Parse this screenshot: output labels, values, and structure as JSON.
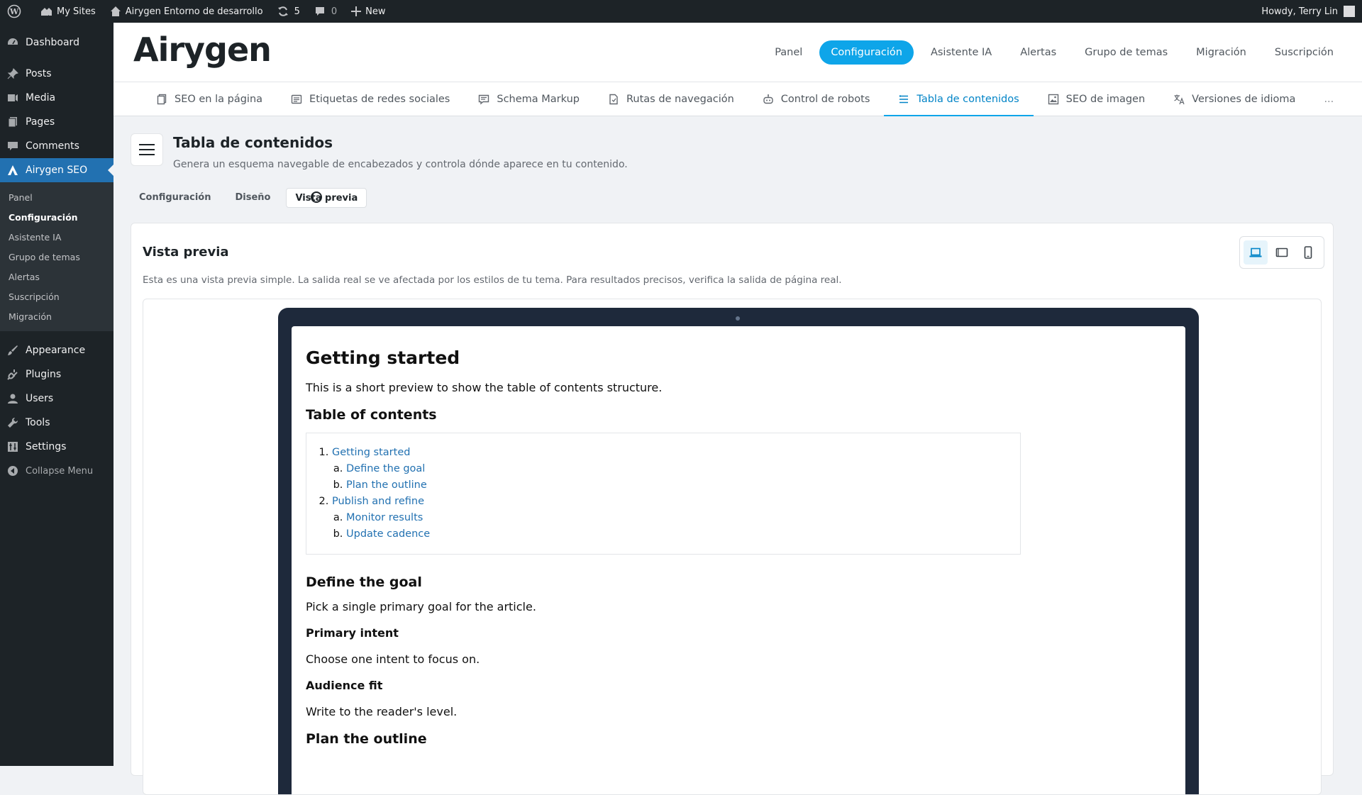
{
  "adminbar": {
    "my_sites": "My Sites",
    "site_name": "Airygen Entorno de desarrollo",
    "updates_count": "5",
    "comments_count": "0",
    "new_label": "New",
    "howdy": "Howdy, Terry Lin"
  },
  "sidebar": {
    "dashboard": "Dashboard",
    "posts": "Posts",
    "media": "Media",
    "pages": "Pages",
    "comments": "Comments",
    "airygen": "Airygen SEO",
    "submenu": [
      "Panel",
      "Configuración",
      "Asistente IA",
      "Grupo de temas",
      "Alertas",
      "Suscripción",
      "Migración"
    ],
    "appearance": "Appearance",
    "plugins": "Plugins",
    "users": "Users",
    "tools": "Tools",
    "settings": "Settings",
    "collapse": "Collapse Menu"
  },
  "logo_text": "Airygen",
  "topnav": [
    "Panel",
    "Configuración",
    "Asistente IA",
    "Alertas",
    "Grupo de temas",
    "Migración",
    "Suscripción"
  ],
  "subtabs": [
    {
      "label": "SEO en la página",
      "icon": "page-copy-icon"
    },
    {
      "label": "Etiquetas de redes sociales",
      "icon": "social-card-icon"
    },
    {
      "label": "Schema Markup",
      "icon": "schema-icon"
    },
    {
      "label": "Rutas de navegación",
      "icon": "breadcrumb-file-icon"
    },
    {
      "label": "Control de robots",
      "icon": "robot-icon"
    },
    {
      "label": "Tabla de contenidos",
      "icon": "list-icon"
    },
    {
      "label": "SEO de imagen",
      "icon": "image-icon"
    },
    {
      "label": "Versiones de idioma",
      "icon": "translate-icon"
    }
  ],
  "subtabs_more": "...",
  "page": {
    "title": "Tabla de contenidos",
    "description": "Genera un esquema navegable de encabezados y controla dónde aparece en tu contenido."
  },
  "section_tabs": [
    "Configuración",
    "Diseño",
    "Vista previa"
  ],
  "card": {
    "title": "Vista previa",
    "description": "Esta es una vista previa simple. La salida real se ve afectada por los estilos de tu tema. Para resultados precisos, verifica la salida de página real."
  },
  "preview": {
    "h1": "Getting started",
    "intro": "This is a short preview to show the table of contents structure.",
    "toc_heading": "Table of contents",
    "toc": [
      {
        "label": "Getting started",
        "children": [
          "Define the goal",
          "Plan the outline"
        ]
      },
      {
        "label": "Publish and refine",
        "children": [
          "Monitor results",
          "Update cadence"
        ]
      }
    ],
    "h2_goal": "Define the goal",
    "goal_text": "Pick a single primary goal for the article.",
    "h3_intent": "Primary intent",
    "intent_text": "Choose one intent to focus on.",
    "h3_audience": "Audience fit",
    "audience_text": "Write to the reader's level.",
    "h2_outline": "Plan the outline"
  },
  "colors": {
    "accent": "#0ea5e9",
    "wp_blue": "#2271b1",
    "admin_dark": "#1d2327"
  }
}
